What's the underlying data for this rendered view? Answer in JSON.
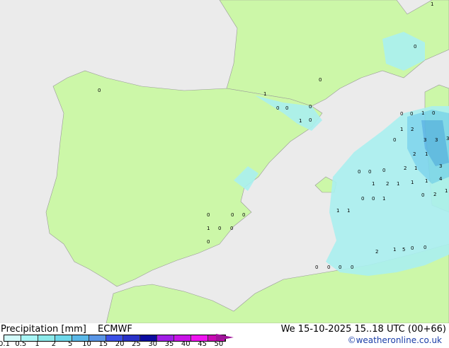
{
  "title": "Precipitation [mm]",
  "model": "ECMWF",
  "datetime": "We 15-10-2025 15..18 UTC (00+66)",
  "copyright": "©weatheronline.co.uk",
  "scale": {
    "labels": [
      "0.1",
      "0.5",
      "1",
      "2",
      "5",
      "10",
      "15",
      "20",
      "25",
      "30",
      "35",
      "40",
      "45",
      "50"
    ],
    "colors": [
      "#d2fafa",
      "#a8f5f5",
      "#8ceaea",
      "#6ed8ea",
      "#5ab8e8",
      "#5a96e6",
      "#3c50e6",
      "#2a32c8",
      "#0c0ca0",
      "#a01ee6",
      "#c814e6",
      "#f014f0",
      "#c80ab4"
    ]
  },
  "colors": {
    "land": "#ccf7a8",
    "sea": "#ebebeb",
    "rain_light": "#aaf0f0",
    "rain_mid": "#7cd6ee",
    "rain_heavy": "#58b6e6"
  },
  "labels": [
    "0",
    "1",
    "0",
    "0",
    "0",
    "1",
    "0",
    "0",
    "0",
    "1",
    "0",
    "0",
    "1",
    "0",
    "1",
    "2",
    "3",
    "3",
    "3",
    "0",
    "2",
    "1",
    "2",
    "1",
    "4",
    "1",
    "3",
    "1",
    "2",
    "0",
    "1",
    "1",
    "2",
    "1",
    "0",
    "0",
    "0",
    "1",
    "1",
    "0",
    "0",
    "1",
    "2",
    "1",
    "5",
    "0",
    "0",
    "0",
    "0",
    "0",
    "1",
    "0",
    "0",
    "0",
    "0",
    "0",
    "0",
    "0"
  ]
}
